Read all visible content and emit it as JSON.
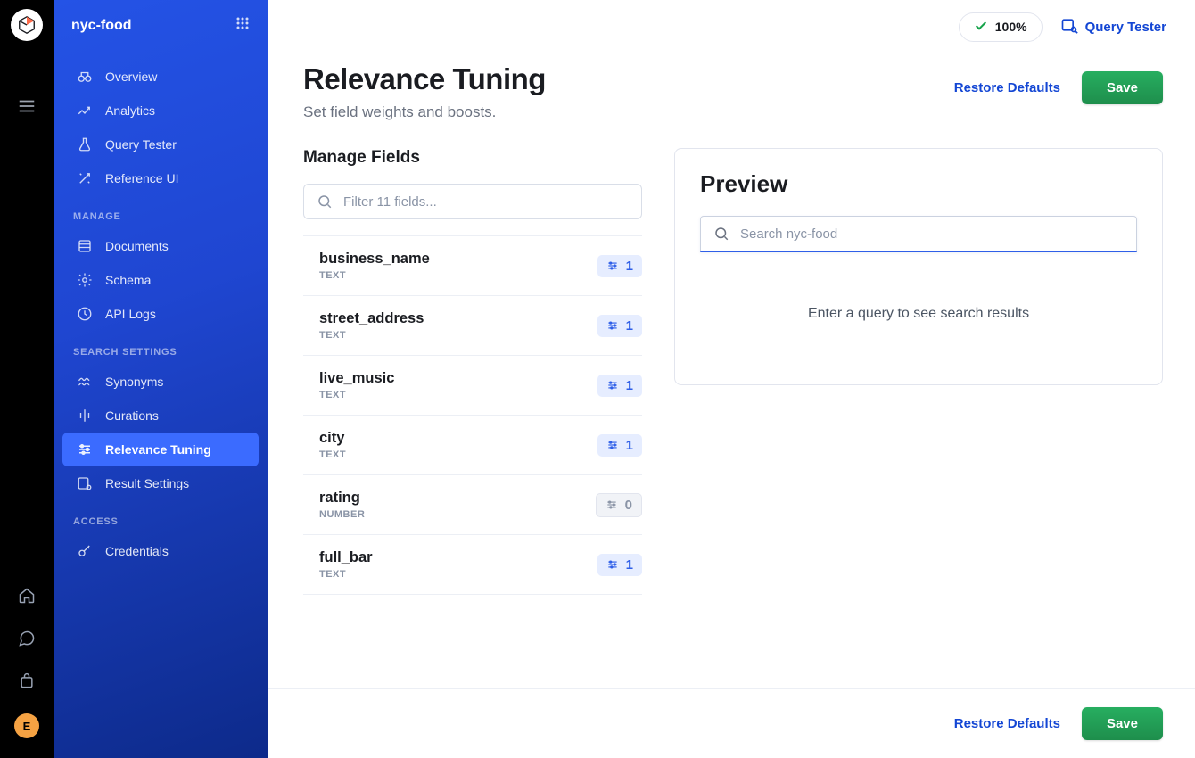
{
  "rail": {
    "avatar_letter": "E"
  },
  "sidebar": {
    "app_name": "nyc-food",
    "sections": {
      "top": [
        {
          "label": "Overview",
          "icon": "binoculars-icon"
        },
        {
          "label": "Analytics",
          "icon": "analytics-icon"
        },
        {
          "label": "Query Tester",
          "icon": "flask-icon"
        },
        {
          "label": "Reference UI",
          "icon": "magic-icon"
        }
      ],
      "manage_label": "MANAGE",
      "manage": [
        {
          "label": "Documents",
          "icon": "documents-icon"
        },
        {
          "label": "Schema",
          "icon": "gear-icon"
        },
        {
          "label": "API Logs",
          "icon": "clock-icon"
        }
      ],
      "search_label": "SEARCH SETTINGS",
      "search": [
        {
          "label": "Synonyms",
          "icon": "waves-icon"
        },
        {
          "label": "Curations",
          "icon": "curations-icon"
        },
        {
          "label": "Relevance Tuning",
          "icon": "sliders-icon",
          "active": true
        },
        {
          "label": "Result Settings",
          "icon": "result-settings-icon"
        }
      ],
      "access_label": "ACCESS",
      "access": [
        {
          "label": "Credentials",
          "icon": "key-icon"
        }
      ]
    }
  },
  "topbar": {
    "health_pct": "100%",
    "query_tester_label": "Query Tester"
  },
  "page": {
    "title": "Relevance Tuning",
    "subtitle": "Set field weights and boosts.",
    "restore_label": "Restore Defaults",
    "save_label": "Save"
  },
  "manage_fields": {
    "title": "Manage Fields",
    "filter_placeholder": "Filter 11 fields...",
    "fields": [
      {
        "name": "business_name",
        "type": "TEXT",
        "weight": "1",
        "enabled": true
      },
      {
        "name": "street_address",
        "type": "TEXT",
        "weight": "1",
        "enabled": true
      },
      {
        "name": "live_music",
        "type": "TEXT",
        "weight": "1",
        "enabled": true
      },
      {
        "name": "city",
        "type": "TEXT",
        "weight": "1",
        "enabled": true
      },
      {
        "name": "rating",
        "type": "NUMBER",
        "weight": "0",
        "enabled": false
      },
      {
        "name": "full_bar",
        "type": "TEXT",
        "weight": "1",
        "enabled": true
      }
    ]
  },
  "preview": {
    "title": "Preview",
    "search_placeholder": "Search nyc-food",
    "empty_text": "Enter a query to see search results"
  },
  "footer": {
    "restore_label": "Restore Defaults",
    "save_label": "Save"
  }
}
